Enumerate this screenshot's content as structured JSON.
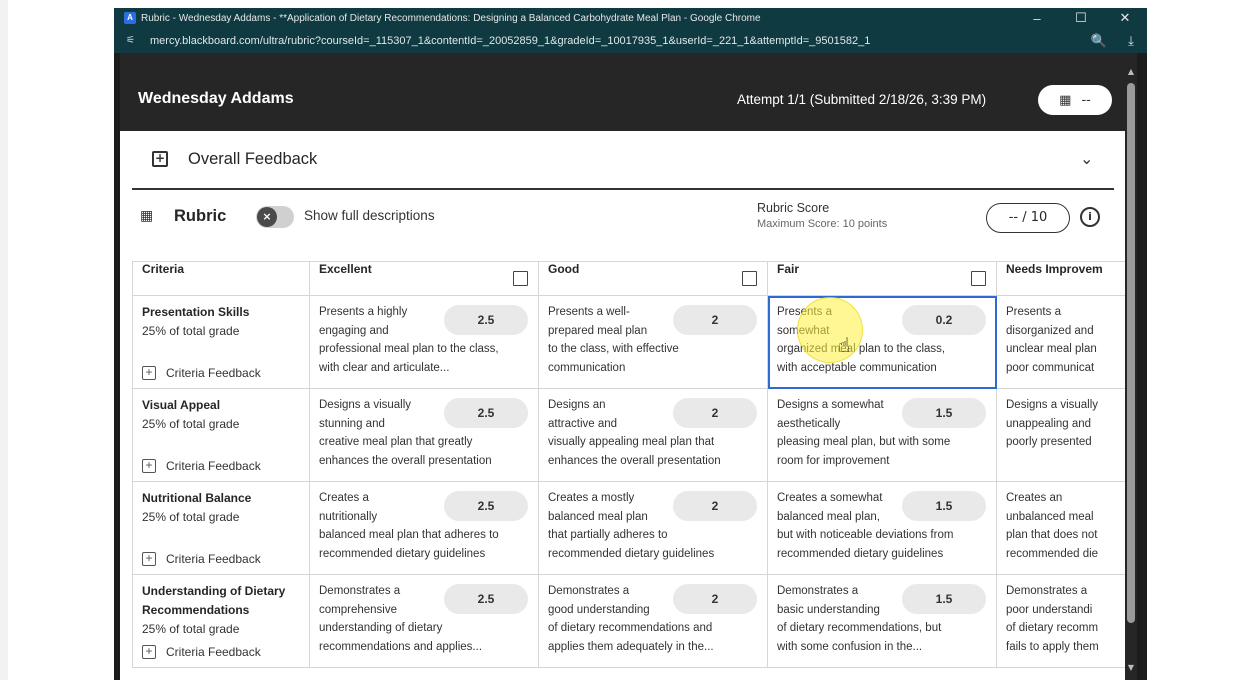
{
  "window": {
    "title": "Rubric - Wednesday Addams - **Application of Dietary Recommendations: Designing a Balanced Carbohydrate Meal Plan - Google Chrome",
    "url": "mercy.blackboard.com/ultra/rubric?courseId=_115307_1&contentId=_20052859_1&gradeId=_10017935_1&userId=_221_1&attemptId=_9501582_1",
    "minimize": "–",
    "maximize": "☐",
    "close": "✕",
    "zoom_icon": "🔍",
    "download_icon": "⤓"
  },
  "header": {
    "student_name": "Wednesday Addams",
    "attempt": "Attempt 1/1 (Submitted 2/18/26, 3:39 PM)",
    "grade_value": "--"
  },
  "overall_feedback": {
    "label": "Overall Feedback"
  },
  "rubric": {
    "title": "Rubric",
    "toggle_label": "Show full descriptions",
    "score_label": "Rubric Score",
    "max_score": "Maximum Score: 10 points",
    "score_value": "-- / 10",
    "columns": [
      "Criteria",
      "Excellent",
      "Good",
      "Fair",
      "Needs Improvem"
    ],
    "feedback_label": "Criteria Feedback",
    "rows": [
      {
        "name": "Presentation Skills",
        "weight": "25% of total grade",
        "cells": [
          {
            "points": "2.5",
            "lines": [
              "Presents a highly",
              "engaging and",
              "professional meal plan to the class,",
              "with clear and articulate..."
            ]
          },
          {
            "points": "2",
            "lines": [
              "Presents a well-",
              "prepared meal plan",
              "to the class, with effective",
              "communication"
            ]
          },
          {
            "points": "0.2",
            "lines": [
              "Presents a",
              "somewhat",
              "organized meal plan to the class,",
              "with acceptable communication"
            ]
          },
          {
            "points": "",
            "lines": [
              "Presents a",
              "disorganized and",
              "unclear meal plan",
              "poor communicat"
            ]
          }
        ]
      },
      {
        "name": "Visual Appeal",
        "weight": "25% of total grade",
        "cells": [
          {
            "points": "2.5",
            "lines": [
              "Designs a visually",
              "stunning and",
              "creative meal plan that greatly",
              "enhances the overall presentation"
            ]
          },
          {
            "points": "2",
            "lines": [
              "Designs an",
              "attractive and",
              "visually appealing meal plan that",
              "enhances the overall presentation"
            ]
          },
          {
            "points": "1.5",
            "lines": [
              "Designs a somewhat",
              "aesthetically",
              "pleasing meal plan, but with some",
              "room for improvement"
            ]
          },
          {
            "points": "",
            "lines": [
              "Designs a visually",
              "unappealing and",
              "poorly presented",
              ""
            ]
          }
        ]
      },
      {
        "name": "Nutritional Balance",
        "weight": "25% of total grade",
        "cells": [
          {
            "points": "2.5",
            "lines": [
              "Creates a",
              "nutritionally",
              "balanced meal plan that adheres to",
              "recommended dietary guidelines"
            ]
          },
          {
            "points": "2",
            "lines": [
              "Creates a mostly",
              "balanced meal plan",
              "that partially adheres to",
              "recommended dietary guidelines"
            ]
          },
          {
            "points": "1.5",
            "lines": [
              "Creates a somewhat",
              "balanced meal plan,",
              "but with noticeable deviations from",
              "recommended dietary guidelines"
            ]
          },
          {
            "points": "",
            "lines": [
              "Creates an",
              "unbalanced meal",
              "plan that does not",
              "recommended die"
            ]
          }
        ]
      },
      {
        "name": "Understanding of Dietary Recommendations",
        "name_lines": [
          "Understanding of Dietary",
          "Recommendations"
        ],
        "weight": "25% of total grade",
        "cells": [
          {
            "points": "2.5",
            "lines": [
              "Demonstrates a",
              "comprehensive",
              "understanding of dietary",
              "recommendations and applies..."
            ]
          },
          {
            "points": "2",
            "lines": [
              "Demonstrates a",
              "good understanding",
              "of dietary recommendations and",
              "applies them adequately in the..."
            ]
          },
          {
            "points": "1.5",
            "lines": [
              "Demonstrates a",
              "basic understanding",
              "of dietary recommendations, but",
              "with some confusion in the..."
            ]
          },
          {
            "points": "",
            "lines": [
              "Demonstrates a",
              "poor understandi",
              "of dietary recomm",
              "fails to apply them"
            ]
          }
        ]
      }
    ]
  }
}
